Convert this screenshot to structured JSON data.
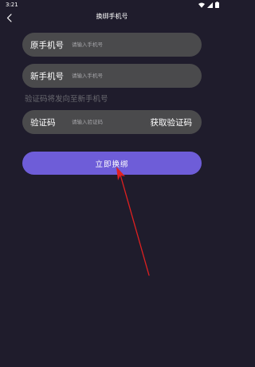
{
  "status_bar": {
    "time": "3:21",
    "icons": [
      "wifi-icon",
      "signal-icon",
      "battery-icon"
    ]
  },
  "header": {
    "title": "换绑手机号",
    "back_icon": "chevron-left-icon"
  },
  "form": {
    "old_phone": {
      "label": "原手机号",
      "placeholder": "请输入手机号",
      "value": ""
    },
    "new_phone": {
      "label": "新手机号",
      "placeholder": "请输入手机号",
      "value": ""
    },
    "hint": "验证码将发向至新手机号",
    "code": {
      "label": "验证码",
      "placeholder": "请输入验证码",
      "value": "",
      "button_label": "获取验证码"
    },
    "submit_label": "立即换绑"
  },
  "colors": {
    "background": "#1f1c2c",
    "field_background": "#4a4a4c",
    "primary_button": "#6e5dd8",
    "annotation_arrow": "#e02020"
  }
}
